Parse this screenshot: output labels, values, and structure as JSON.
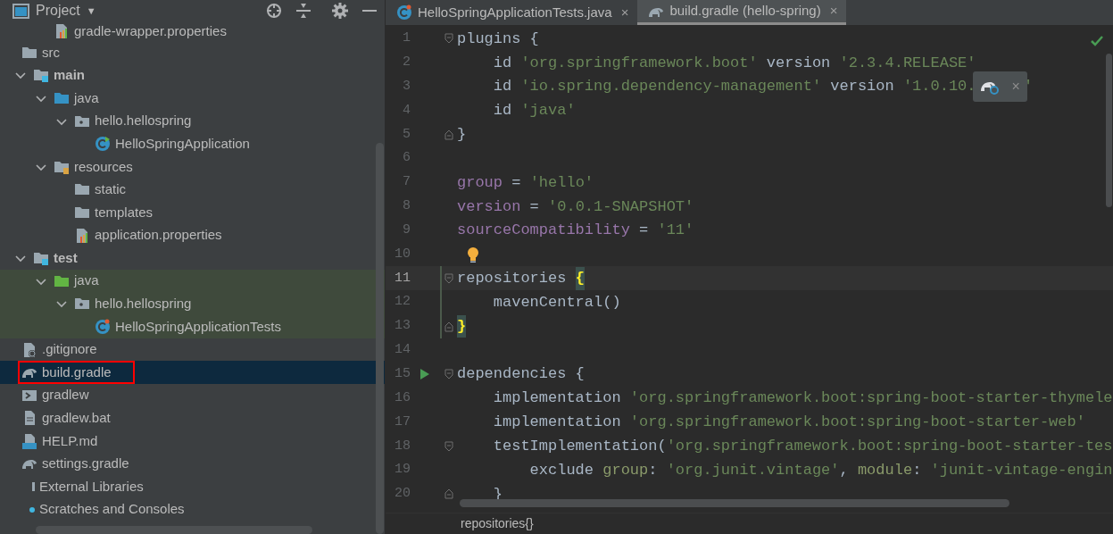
{
  "project_panel": {
    "title": "Project",
    "dropdown": "▼",
    "cut_row": {
      "label": "gradle-wrapper.properties",
      "kind": "properties"
    },
    "tree": [
      {
        "label": "src",
        "kind": "folder",
        "children": [
          {
            "label": "main",
            "kind": "module",
            "expanded": true,
            "children": [
              {
                "label": "java",
                "kind": "source",
                "expanded": true,
                "children": [
                  {
                    "label": "hello.hellospring",
                    "kind": "package",
                    "expanded": true,
                    "children": [
                      {
                        "label": "HelloSpringApplication",
                        "kind": "class"
                      }
                    ]
                  }
                ]
              },
              {
                "label": "resources",
                "kind": "resources",
                "expanded": true,
                "children": [
                  {
                    "label": "static",
                    "kind": "folder"
                  },
                  {
                    "label": "templates",
                    "kind": "folder"
                  },
                  {
                    "label": "application.properties",
                    "kind": "properties"
                  }
                ]
              }
            ]
          },
          {
            "label": "test",
            "kind": "module",
            "expanded": true,
            "children": [
              {
                "label": "java",
                "kind": "testsource",
                "expanded": true,
                "tinted": true,
                "children": [
                  {
                    "label": "hello.hellospring",
                    "kind": "package",
                    "expanded": true,
                    "tinted": true,
                    "children": [
                      {
                        "label": "HelloSpringApplicationTests",
                        "kind": "testclass",
                        "tinted": true
                      }
                    ]
                  }
                ]
              }
            ]
          }
        ]
      },
      {
        "label": ".gitignore",
        "kind": "ignore"
      },
      {
        "label": "build.gradle",
        "kind": "gradle",
        "selected": true,
        "annotated": true
      },
      {
        "label": "gradlew",
        "kind": "script"
      },
      {
        "label": "gradlew.bat",
        "kind": "text"
      },
      {
        "label": "HELP.md",
        "kind": "markdown"
      },
      {
        "label": "settings.gradle",
        "kind": "gradle"
      },
      {
        "label": "External Libraries",
        "kind": "library"
      },
      {
        "label": "Scratches and Consoles",
        "kind": "scratches"
      }
    ]
  },
  "tabs": [
    {
      "label": "HelloSpringApplicationTests.java",
      "kind": "testclass",
      "selected": false,
      "close": "×"
    },
    {
      "label": "build.gradle (hello-spring)",
      "kind": "gradle",
      "selected": true,
      "close": "×"
    }
  ],
  "editor": {
    "lines": [
      {
        "no": "1",
        "fold_open": true,
        "tokens": [
          {
            "kind": "plain",
            "t": "plugins {"
          }
        ]
      },
      {
        "no": "2",
        "tokens": [
          {
            "kind": "plain",
            "t": "    id "
          },
          {
            "kind": "string",
            "t": "'org.springframework.boot'"
          },
          {
            "kind": "plain",
            "t": " version "
          },
          {
            "kind": "string",
            "t": "'2.3.4.RELEASE'"
          }
        ]
      },
      {
        "no": "3",
        "tokens": [
          {
            "kind": "plain",
            "t": "    id "
          },
          {
            "kind": "string",
            "t": "'io.spring.dependency-management'"
          },
          {
            "kind": "plain",
            "t": " version "
          },
          {
            "kind": "string",
            "t": "'1.0.10."
          },
          {
            "kind": "popup",
            "t": "×"
          },
          {
            "kind": "string",
            "t": "'"
          }
        ]
      },
      {
        "no": "4",
        "tokens": [
          {
            "kind": "plain",
            "t": "    id "
          },
          {
            "kind": "string",
            "t": "'java'"
          }
        ]
      },
      {
        "no": "5",
        "fold_close": true,
        "tokens": [
          {
            "kind": "plain",
            "t": "}"
          }
        ]
      },
      {
        "no": "6"
      },
      {
        "no": "7",
        "tokens": [
          {
            "kind": "prop",
            "t": "group"
          },
          {
            "kind": "plain",
            "t": " = "
          },
          {
            "kind": "string",
            "t": "'hello'"
          }
        ]
      },
      {
        "no": "8",
        "tokens": [
          {
            "kind": "prop",
            "t": "version"
          },
          {
            "kind": "plain",
            "t": " = "
          },
          {
            "kind": "string",
            "t": "'0.0.1-SNAPSHOT'"
          }
        ]
      },
      {
        "no": "9",
        "tokens": [
          {
            "kind": "prop",
            "t": "sourceCompatibility"
          },
          {
            "kind": "plain",
            "t": " = "
          },
          {
            "kind": "string",
            "t": "'11'"
          }
        ]
      },
      {
        "no": "10",
        "bulb": true
      },
      {
        "no": "11",
        "current": true,
        "modified": true,
        "fold_open": true,
        "tokens": [
          {
            "kind": "plain",
            "t": "repositories "
          },
          {
            "kind": "match",
            "t": "{"
          }
        ]
      },
      {
        "no": "12",
        "modified": true,
        "tokens": [
          {
            "kind": "plain",
            "t": "    mavenCentral()"
          }
        ]
      },
      {
        "no": "13",
        "modified": true,
        "fold_close": true,
        "tokens": [
          {
            "kind": "match",
            "t": "}"
          }
        ]
      },
      {
        "no": "14"
      },
      {
        "no": "15",
        "run": true,
        "fold_open": true,
        "tokens": [
          {
            "kind": "plain",
            "t": "dependencies {"
          }
        ]
      },
      {
        "no": "16",
        "tokens": [
          {
            "kind": "plain",
            "t": "    implementation "
          },
          {
            "kind": "string",
            "t": "'org.springframework.boot:spring-boot-starter-thymele"
          }
        ]
      },
      {
        "no": "17",
        "tokens": [
          {
            "kind": "plain",
            "t": "    implementation "
          },
          {
            "kind": "string",
            "t": "'org.springframework.boot:spring-boot-starter-web'"
          }
        ]
      },
      {
        "no": "18",
        "fold_open": true,
        "tokens": [
          {
            "kind": "plain",
            "t": "    testImplementation("
          },
          {
            "kind": "string",
            "t": "'org.springframework.boot:spring-boot-starter-tes"
          }
        ]
      },
      {
        "no": "19",
        "tokens": [
          {
            "kind": "plain",
            "t": "        exclude "
          },
          {
            "kind": "named",
            "t": "group"
          },
          {
            "kind": "plain",
            "t": ": "
          },
          {
            "kind": "string",
            "t": "'org.junit.vintage'"
          },
          {
            "kind": "plain",
            "t": ", "
          },
          {
            "kind": "named",
            "t": "module"
          },
          {
            "kind": "plain",
            "t": ": "
          },
          {
            "kind": "string",
            "t": "'junit-vintage-engin"
          }
        ]
      },
      {
        "no": "20",
        "fold_close": true,
        "tokens": [
          {
            "kind": "plain",
            "t": "    }"
          }
        ]
      }
    ],
    "breadcrumb": "repositories{}"
  }
}
